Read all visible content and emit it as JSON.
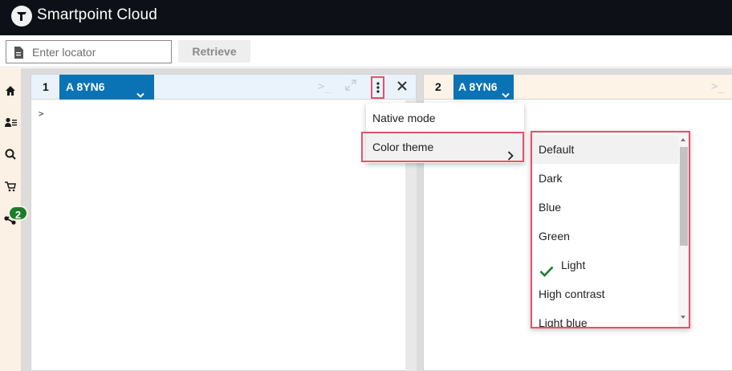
{
  "app": {
    "title": "Smartpoint Cloud"
  },
  "locator": {
    "placeholder": "Enter locator",
    "retrieve_label": "Retrieve"
  },
  "nav": {
    "items": [
      {
        "name": "home-icon"
      },
      {
        "name": "user-list-icon"
      },
      {
        "name": "search-icon"
      },
      {
        "name": "cart-icon"
      },
      {
        "name": "share-icon",
        "badge": "2"
      }
    ],
    "badge_color": "#1d7c2c"
  },
  "pane1": {
    "number": "1",
    "tab_label": "A 8YN6",
    "prompt": ">"
  },
  "pane2": {
    "number": "2",
    "tab_label": "A 8YN6"
  },
  "context_menu": {
    "items": [
      {
        "label": "Native mode"
      },
      {
        "label": "Color theme",
        "has_submenu": true
      }
    ]
  },
  "color_theme_submenu": {
    "items": [
      {
        "label": "Default",
        "hovered": true
      },
      {
        "label": "Dark"
      },
      {
        "label": "Blue"
      },
      {
        "label": "Green"
      },
      {
        "label": "Light",
        "selected": true
      },
      {
        "label": "High contrast"
      },
      {
        "label": "Light blue"
      }
    ]
  },
  "colors": {
    "accent_tab": "#0a73b5",
    "highlight_border": "#e8506b",
    "topbar": "#0d1117",
    "check": "#1d7c2c"
  }
}
